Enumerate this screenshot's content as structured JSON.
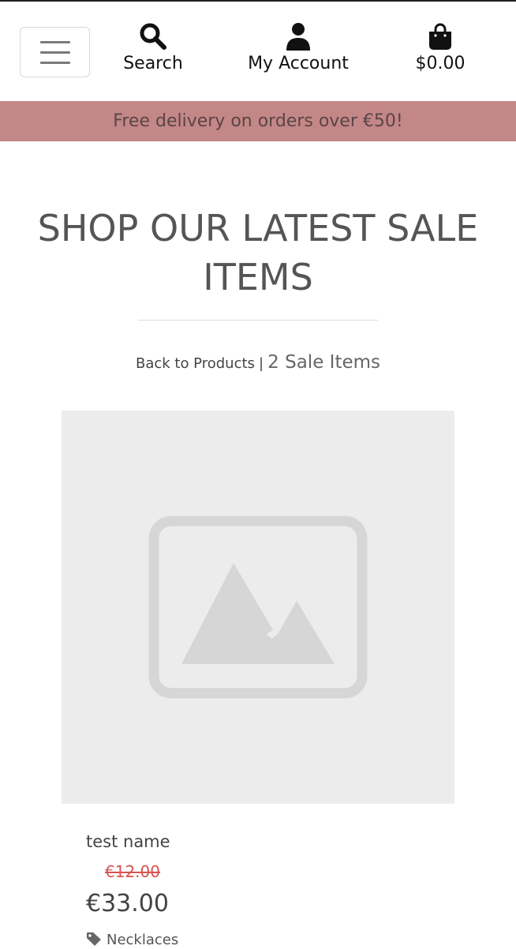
{
  "nav": {
    "search_label": "Search",
    "account_label": "My Account",
    "cart_label": "$0.00"
  },
  "banner": {
    "text": "Free delivery on orders over €50!"
  },
  "heading": {
    "title": "SHOP OUR LATEST SALE ITEMS"
  },
  "subheader": {
    "back_link": "Back to Products",
    "separator": "|",
    "count_text": "2 Sale Items"
  },
  "products": [
    {
      "name": "test name",
      "old_price": "€12.00",
      "price": "€33.00",
      "category": "Necklaces",
      "image_icon": "image-placeholder-icon"
    }
  ],
  "colors": {
    "banner_bg": "#c48787",
    "sale_red": "#d9534f",
    "image_bg": "#ececec"
  }
}
